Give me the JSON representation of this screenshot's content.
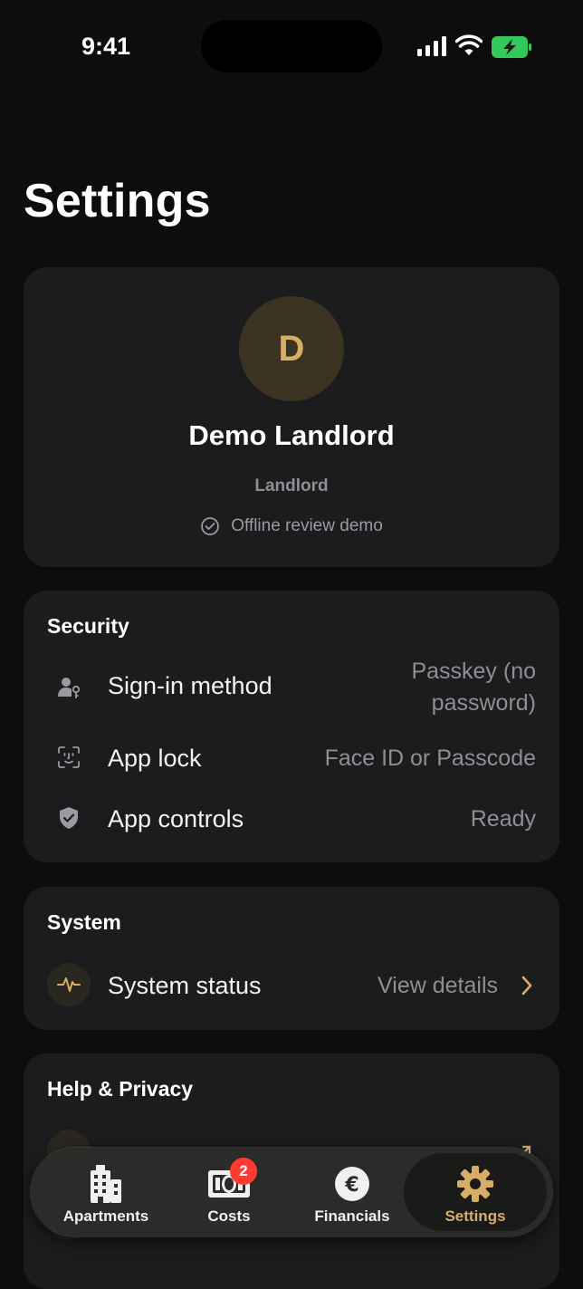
{
  "status_bar": {
    "time": "9:41"
  },
  "page": {
    "title": "Settings"
  },
  "profile": {
    "initial": "D",
    "name": "Demo Landlord",
    "role": "Landlord",
    "status": "Offline review demo"
  },
  "security": {
    "title": "Security",
    "rows": [
      {
        "label": "Sign-in method",
        "value_line1": "Passkey (no",
        "value_line2": "password)"
      },
      {
        "label": "App lock",
        "value": "Face ID or Passcode"
      },
      {
        "label": "App controls",
        "value": "Ready"
      }
    ]
  },
  "system": {
    "title": "System",
    "rows": [
      {
        "label": "System status",
        "value": "View details"
      }
    ]
  },
  "help": {
    "title": "Help & Privacy"
  },
  "tabs": [
    {
      "label": "Apartments",
      "icon": "building-icon"
    },
    {
      "label": "Costs",
      "icon": "banknote-icon",
      "badge": "2"
    },
    {
      "label": "Financials",
      "icon": "euro-icon"
    },
    {
      "label": "Settings",
      "icon": "gear-icon"
    }
  ],
  "colors": {
    "accent": "#d8ad66",
    "badge": "#ff3b30",
    "battery": "#34c759",
    "card": "#1c1c1e"
  }
}
